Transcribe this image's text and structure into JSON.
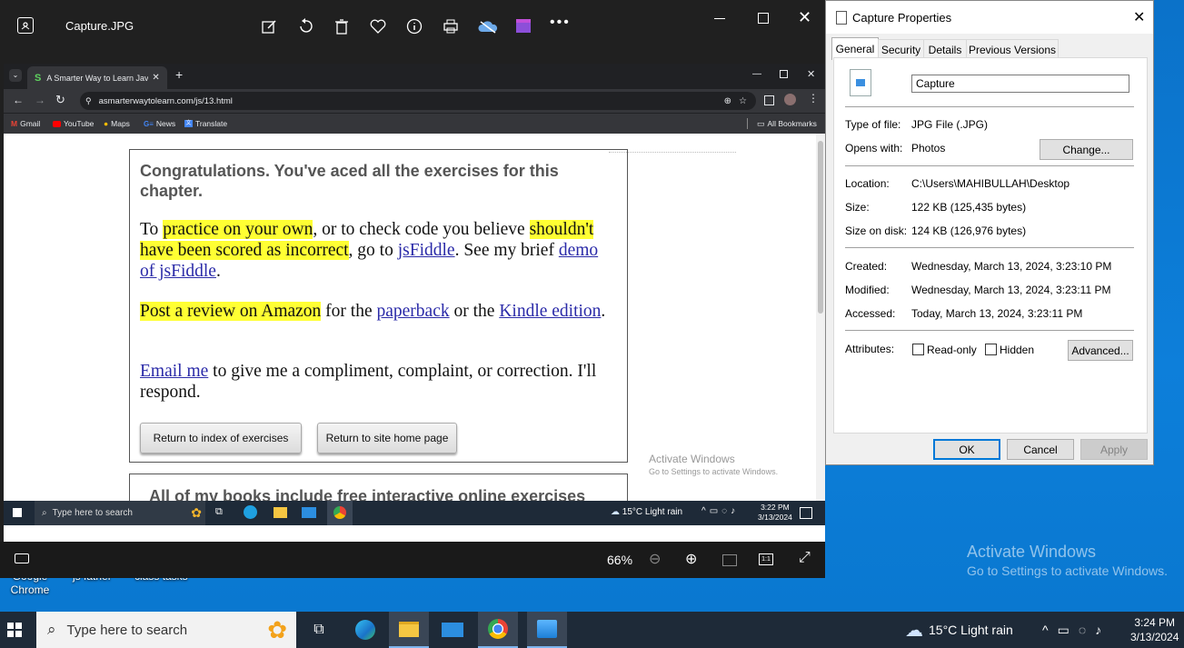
{
  "desktop": {
    "icon_labels": [
      "Google\nChrome",
      "js father",
      "class tasks"
    ],
    "activate": {
      "title": "Activate Windows",
      "subtitle": "Go to Settings to activate Windows."
    }
  },
  "taskbar": {
    "search_placeholder": "Type here to search",
    "weather": "15°C  Light rain",
    "time": "3:24 PM",
    "date": "3/13/2024"
  },
  "photos": {
    "title": "Capture.JPG",
    "zoom": "66%"
  },
  "browser": {
    "tab_title": "A Smarter Way to Learn JavaSc",
    "url": "asmarterwaytolearn.com/js/13.html",
    "bookmarks": [
      "Gmail",
      "YouTube",
      "Maps",
      "News",
      "Translate"
    ],
    "all_bookmarks": "All Bookmarks"
  },
  "webpage": {
    "heading": "Congratulations. You've aced all the exercises for this chapter.",
    "p1": {
      "a": "To ",
      "hl1": "practice on your own",
      "b": ", or to check code you believe ",
      "hl2": "shouldn't have been scored as incorrect",
      "c": ", go to ",
      "link1": "jsFiddle",
      "d": ". See my brief ",
      "link2": "demo of jsFiddle",
      "e": "."
    },
    "p2": {
      "hl": "Post a review on Amazon",
      "a": " for the ",
      "link1": "paperback",
      "b": " or the ",
      "link2": "Kindle edition",
      "c": "."
    },
    "p3": {
      "link": "Email me",
      "a": " to give me a compliment, complaint, or correction. I'll respond."
    },
    "btn_index": "Return to index of exercises",
    "btn_home": "Return to site home page",
    "next_heading": "All of my books include free interactive online exercises"
  },
  "inner_taskbar": {
    "search_placeholder": "Type here to search",
    "weather": "15°C  Light rain",
    "time": "3:22 PM",
    "date": "3/13/2024",
    "activate_title": "Activate Windows",
    "activate_subtitle": "Go to Settings to activate Windows."
  },
  "properties": {
    "title": "Capture Properties",
    "tabs": [
      "General",
      "Security",
      "Details",
      "Previous Versions"
    ],
    "filename": "Capture",
    "type_label": "Type of file:",
    "type_value": "JPG File (.JPG)",
    "opens_label": "Opens with:",
    "opens_value": "Photos",
    "change_btn": "Change...",
    "location_label": "Location:",
    "location_value": "C:\\Users\\MAHIBULLAH\\Desktop",
    "size_label": "Size:",
    "size_value": "122 KB (125,435 bytes)",
    "disk_label": "Size on disk:",
    "disk_value": "124 KB (126,976 bytes)",
    "created_label": "Created:",
    "created_value": "Wednesday, March 13, 2024, 3:23:10 PM",
    "modified_label": "Modified:",
    "modified_value": "Wednesday, March 13, 2024, 3:23:11 PM",
    "accessed_label": "Accessed:",
    "accessed_value": "Today, March 13, 2024, 3:23:11 PM",
    "attributes_label": "Attributes:",
    "readonly": "Read-only",
    "hidden": "Hidden",
    "advanced_btn": "Advanced...",
    "ok": "OK",
    "cancel": "Cancel",
    "apply": "Apply"
  },
  "colors": {
    "highlight": "#ffff33",
    "link": "#2a2aa8",
    "desktop": "#0a7fd6",
    "taskbar": "#1e2a38"
  }
}
